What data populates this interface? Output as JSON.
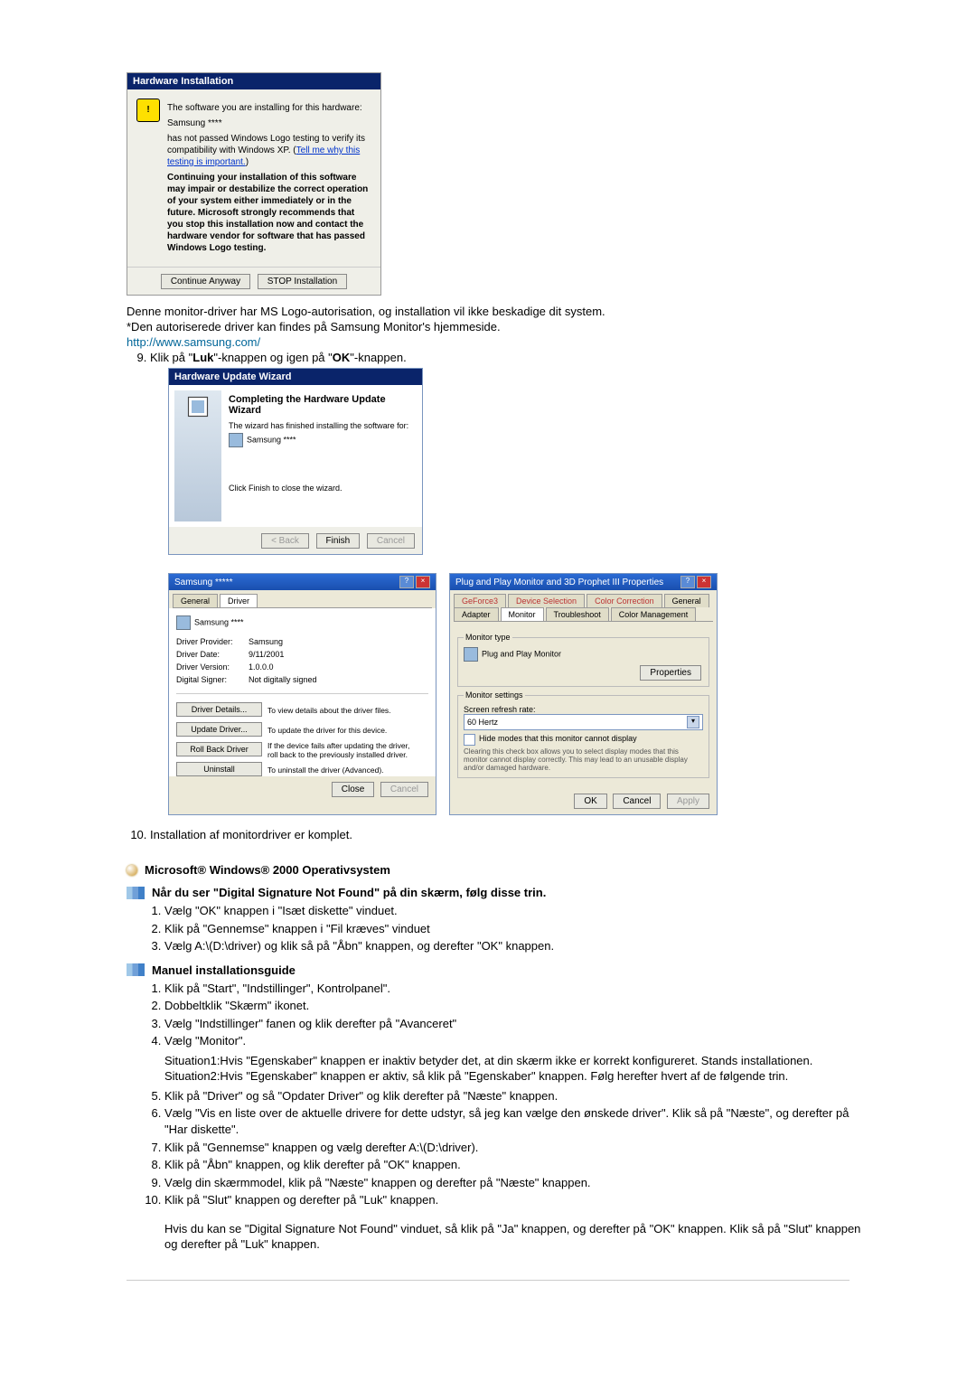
{
  "dialog1": {
    "title": "Hardware Installation",
    "line1": "The software you are installing for this hardware:",
    "device": "Samsung ****",
    "line2a": "has not passed Windows Logo testing to verify its compatibility with Windows XP. (",
    "tellme": "Tell me why this testing is important.",
    "line2b": ")",
    "warn": "Continuing your installation of this software may impair or destabilize the correct operation of your system either immediately or in the future. Microsoft strongly recommends that you stop this installation now and contact the hardware vendor for software that has passed Windows Logo testing.",
    "btn_continue": "Continue Anyway",
    "btn_stop": "STOP Installation"
  },
  "para1a": "Denne monitor-driver har MS Logo-autorisation, og installation vil ikke beskadige dit system.",
  "para1b": "*Den autoriserede driver kan findes på Samsung Monitor's hjemmeside.",
  "samsung_url": "http://www.samsung.com/",
  "step9_pre": "Klik på \"",
  "step9_luk": "Luk",
  "step9_mid": "\"-knappen og igen på \"",
  "step9_ok": "OK",
  "step9_post": "\"-knappen.",
  "wizard": {
    "title": "Hardware Update Wizard",
    "heading": "Completing the Hardware Update Wizard",
    "line1": "The wizard has finished installing the software for:",
    "device": "Samsung ****",
    "line2": "Click Finish to close the wizard.",
    "back": "< Back",
    "finish": "Finish",
    "cancel": "Cancel"
  },
  "drv": {
    "title": "Samsung *****",
    "tab_general": "General",
    "tab_driver": "Driver",
    "device": "Samsung ****",
    "rows": {
      "provider_label": "Driver Provider:",
      "provider": "Samsung",
      "date_label": "Driver Date:",
      "date": "9/11/2001",
      "version_label": "Driver Version:",
      "version": "1.0.0.0",
      "signer_label": "Digital Signer:",
      "signer": "Not digitally signed"
    },
    "btn_details": "Driver Details...",
    "desc_details": "To view details about the driver files.",
    "btn_update": "Update Driver...",
    "desc_update": "To update the driver for this device.",
    "btn_rollback": "Roll Back Driver",
    "desc_rollback": "If the device fails after updating the driver, roll back to the previously installed driver.",
    "btn_uninstall": "Uninstall",
    "desc_uninstall": "To uninstall the driver (Advanced).",
    "close": "Close",
    "cancel": "Cancel"
  },
  "pnp": {
    "title": "Plug and Play Monitor and 3D Prophet III Properties",
    "tabs": {
      "a": "GeForce3",
      "b": "Device Selection",
      "c": "Color Correction",
      "d": "General",
      "e": "Adapter",
      "f": "Monitor",
      "g": "Troubleshoot",
      "h": "Color Management"
    },
    "montype_legend": "Monitor type",
    "montype": "Plug and Play Monitor",
    "properties": "Properties",
    "monset_legend": "Monitor settings",
    "refresh_label": "Screen refresh rate:",
    "refresh": "60 Hertz",
    "hide": "Hide modes that this monitor cannot display",
    "hide_note": "Clearing this check box allows you to select display modes that this monitor cannot display correctly. This may lead to an unusable display and/or damaged hardware.",
    "ok": "OK",
    "cancel": "Cancel",
    "apply": "Apply"
  },
  "step10": "Installation af monitordriver er komplet.",
  "win2000_heading": "Microsoft® Windows® 2000 Operativsystem",
  "sigA_heading": "Når du ser \"Digital Signature Not Found\" på din skærm, følg disse trin.",
  "sigA": {
    "s1": "Vælg \"OK\" knappen i \"Isæt diskette\" vinduet.",
    "s2": "Klik på \"Gennemse\" knappen i \"Fil kræves\" vinduet",
    "s3": "Vælg A:\\(D:\\driver) og klik så på \"Åbn\" knappen, og derefter \"OK\" knappen."
  },
  "manual_heading": "Manuel installationsguide",
  "manual": {
    "s1": "Klik på \"Start\", \"Indstillinger\", Kontrolpanel\".",
    "s2": "Dobbeltklik \"Skærm\" ikonet.",
    "s3": "Vælg \"Indstillinger\" fanen og klik derefter på \"Avanceret\"",
    "s4": "Vælg \"Monitor\".",
    "sit1": "Situation1:Hvis \"Egenskaber\" knappen er inaktiv betyder det, at din skærm ikke er korrekt konfigureret. Stands installationen.",
    "sit2": "Situation2:Hvis \"Egenskaber\" knappen er aktiv, så klik på \"Egenskaber\" knappen. Følg herefter hvert af de følgende trin.",
    "s5": "Klik på \"Driver\" og så \"Opdater Driver\" og klik derefter på \"Næste\" knappen.",
    "s6": "Vælg \"Vis en liste over de aktuelle drivere for dette udstyr, så jeg kan vælge den ønskede driver\". Klik så på \"Næste\", og derefter på \"Har diskette\".",
    "s7": "Klik på \"Gennemse\" knappen og vælg derefter A:\\(D:\\driver).",
    "s8": "Klik på \"Åbn\" knappen, og klik derefter på \"OK\" knappen.",
    "s9": "Vælg din skærmmodel, klik på \"Næste\" knappen og derefter på \"Næste\" knappen.",
    "s10": "Klik på \"Slut\" knappen og derefter på \"Luk\" knappen."
  },
  "footer": "Hvis du kan se \"Digital Signature Not Found\" vinduet, så klik på \"Ja\" knappen, og derefter på \"OK\" knappen. Klik så på \"Slut\" knappen og derefter på \"Luk\" knappen."
}
